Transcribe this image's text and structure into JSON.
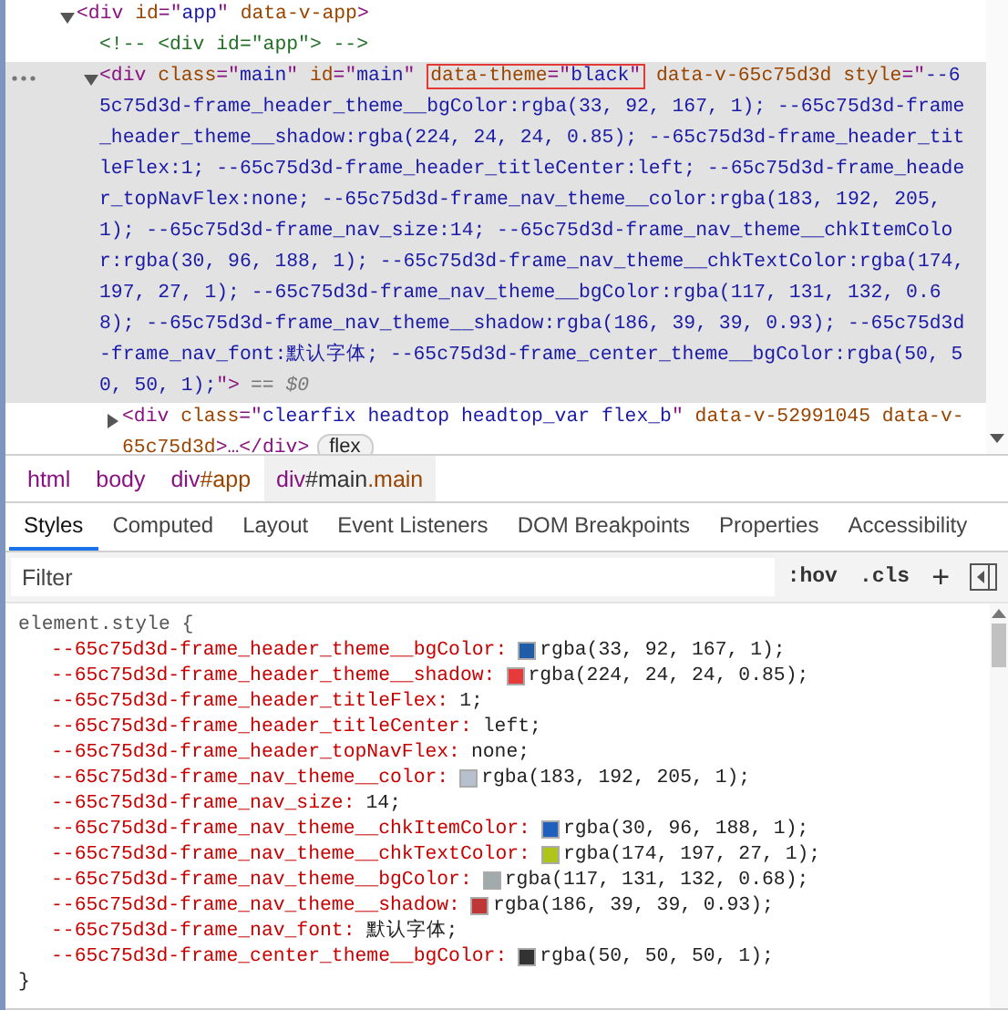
{
  "dom_tree": [
    {
      "kind": "element",
      "expanded": true,
      "selected": false,
      "parts": [
        {
          "boxed": false,
          "segments": [
            {
              "kind": "tag",
              "text": "<div"
            },
            {
              "kind": "attr",
              "text": " id"
            },
            {
              "kind": "tag",
              "text": "=\""
            },
            {
              "kind": "value",
              "text": "app"
            },
            {
              "kind": "tag",
              "text": "\""
            },
            {
              "kind": "attr",
              "text": " data-v-app"
            },
            {
              "kind": "tag",
              "text": ">"
            }
          ]
        }
      ],
      "children": [
        {
          "kind": "comment",
          "selected": false,
          "text": "<!-- <div id=\"app\"> -->"
        },
        {
          "kind": "element",
          "expanded": true,
          "selected": true,
          "marker": "== $0",
          "parts": [
            {
              "boxed": false,
              "segments": [
                {
                  "kind": "tag",
                  "text": "<div"
                },
                {
                  "kind": "attr",
                  "text": " class"
                },
                {
                  "kind": "tag",
                  "text": "=\""
                },
                {
                  "kind": "value",
                  "text": "main"
                },
                {
                  "kind": "tag",
                  "text": "\""
                },
                {
                  "kind": "attr",
                  "text": " id"
                },
                {
                  "kind": "tag",
                  "text": "=\""
                },
                {
                  "kind": "value",
                  "text": "main"
                },
                {
                  "kind": "tag",
                  "text": "\" "
                }
              ]
            },
            {
              "boxed": true,
              "segments": [
                {
                  "kind": "attr",
                  "text": "data-theme"
                },
                {
                  "kind": "tag",
                  "text": "=\""
                },
                {
                  "kind": "value",
                  "text": "black"
                },
                {
                  "kind": "tag",
                  "text": "\""
                }
              ]
            },
            {
              "boxed": false,
              "segments": [
                {
                  "kind": "attr",
                  "text": " data-v-65c75d3d style"
                },
                {
                  "kind": "tag",
                  "text": "=\""
                },
                {
                  "kind": "value",
                  "text": "--65c75d3d-frame_header_theme__bgColor:rgba(33, 92, 167, 1); --65c75d3d-frame_header_theme__shadow:rgba(224, 24, 24, 0.85); --65c75d3d-frame_header_titleFlex:1; --65c75d3d-frame_header_titleCenter:left; --65c75d3d-frame_header_topNavFlex:none; --65c75d3d-frame_nav_theme__color:rgba(183, 192, 205, 1); --65c75d3d-frame_nav_size:14; --65c75d3d-frame_nav_theme__chkItemColor:rgba(30, 96, 188, 1); --65c75d3d-frame_nav_theme__chkTextColor:rgba(174, 197, 27, 1); --65c75d3d-frame_nav_theme__bgColor:rgba(117, 131, 132, 0.68); --65c75d3d-frame_nav_theme__shadow:rgba(186, 39, 39, 0.93); --65c75d3d-frame_nav_font:默认字体; --65c75d3d-frame_center_theme__bgColor:rgba(50, 50, 50, 1);"
                },
                {
                  "kind": "tag",
                  "text": "\">"
                }
              ]
            }
          ],
          "children": [
            {
              "kind": "element",
              "expanded": false,
              "selected": false,
              "badge": "flex",
              "parts": [
                {
                  "boxed": false,
                  "segments": [
                    {
                      "kind": "tag",
                      "text": "<div"
                    },
                    {
                      "kind": "attr",
                      "text": " class"
                    },
                    {
                      "kind": "tag",
                      "text": "=\""
                    },
                    {
                      "kind": "value",
                      "text": "clearfix headtop headtop_var flex_b"
                    },
                    {
                      "kind": "tag",
                      "text": "\""
                    },
                    {
                      "kind": "attr",
                      "text": " data-v-52991045 data-v-65c75d3d"
                    },
                    {
                      "kind": "tag",
                      "text": ">…</div>"
                    }
                  ]
                }
              ]
            }
          ]
        }
      ]
    }
  ],
  "breadcrumbs": [
    {
      "selected": false,
      "segments": [
        {
          "kind": "tag",
          "text": "html"
        }
      ]
    },
    {
      "selected": false,
      "segments": [
        {
          "kind": "tag",
          "text": "body"
        }
      ]
    },
    {
      "selected": false,
      "segments": [
        {
          "kind": "tag",
          "text": "div"
        },
        {
          "kind": "id",
          "text": "#app"
        }
      ]
    },
    {
      "selected": true,
      "segments": [
        {
          "kind": "tag",
          "text": "div"
        },
        {
          "kind": "id",
          "text": "#main"
        },
        {
          "kind": "class",
          "text": ".main"
        }
      ]
    }
  ],
  "tabs": [
    {
      "label": "Styles",
      "selected": true
    },
    {
      "label": "Computed",
      "selected": false
    },
    {
      "label": "Layout",
      "selected": false
    },
    {
      "label": "Event Listeners",
      "selected": false
    },
    {
      "label": "DOM Breakpoints",
      "selected": false
    },
    {
      "label": "Properties",
      "selected": false
    },
    {
      "label": "Accessibility",
      "selected": false
    }
  ],
  "filter": {
    "placeholder": "Filter",
    "hov_button": ":hov",
    "cls_button": ".cls",
    "new_rule_button": "+"
  },
  "styles": {
    "selector": "element.style {",
    "closing": "}",
    "properties": [
      {
        "name": "--65c75d3d-frame_header_theme__bgColor:",
        "color": "#215ca7",
        "value": "rgba(33, 92, 167, 1);"
      },
      {
        "name": "--65c75d3d-frame_header_theme__shadow:",
        "color": "#e53b3b",
        "value": "rgba(224, 24, 24, 0.85);"
      },
      {
        "name": "--65c75d3d-frame_header_titleFlex:",
        "value": "1;"
      },
      {
        "name": "--65c75d3d-frame_header_titleCenter:",
        "value": "left;"
      },
      {
        "name": "--65c75d3d-frame_header_topNavFlex:",
        "value": "none;"
      },
      {
        "name": "--65c75d3d-frame_nav_theme__color:",
        "color": "#b7c0cd",
        "value": "rgba(183, 192, 205, 1);"
      },
      {
        "name": "--65c75d3d-frame_nav_size:",
        "value": "14;"
      },
      {
        "name": "--65c75d3d-frame_nav_theme__chkItemColor:",
        "color": "#1e60bc",
        "value": "rgba(30, 96, 188, 1);"
      },
      {
        "name": "--65c75d3d-frame_nav_theme__chkTextColor:",
        "color": "#aec51b",
        "value": "rgba(174, 197, 27, 1);"
      },
      {
        "name": "--65c75d3d-frame_nav_theme__bgColor:",
        "color": "#a1abab",
        "value": "rgba(117, 131, 132, 0.68);"
      },
      {
        "name": "--65c75d3d-frame_nav_theme__shadow:",
        "color": "#bf3636",
        "value": "rgba(186, 39, 39, 0.93);"
      },
      {
        "name": "--65c75d3d-frame_nav_font:",
        "value": "默认字体;"
      },
      {
        "name": "--65c75d3d-frame_center_theme__bgColor:",
        "color": "#323232",
        "value": "rgba(50, 50, 50, 1);"
      }
    ]
  }
}
